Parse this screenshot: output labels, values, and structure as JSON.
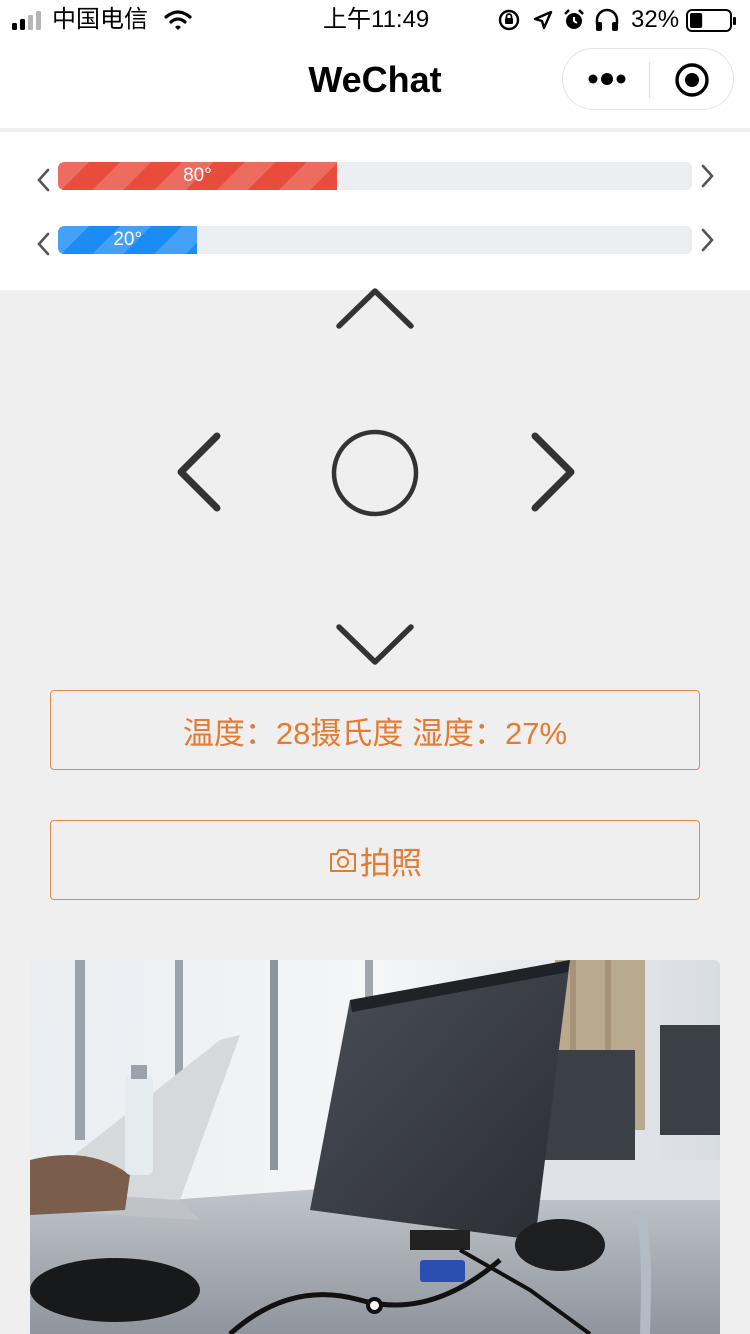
{
  "status_bar": {
    "carrier": "中国电信",
    "time": "上午11:49",
    "battery": "32%",
    "battery_level": 0.32
  },
  "nav": {
    "title": "WeChat",
    "more_icon": "more-dots-icon",
    "close_icon": "capsule-target-icon"
  },
  "sliders": [
    {
      "label": "80°",
      "value_percent": 44,
      "color": "#e84c3d"
    },
    {
      "label": "20°",
      "value_percent": 22,
      "color": "#1b8cf4"
    }
  ],
  "sensor": {
    "text": "温度：28摄氏度 湿度：27%",
    "color": "#e67a30"
  },
  "camera_button": {
    "label": "拍照",
    "icon": "camera-icon"
  }
}
